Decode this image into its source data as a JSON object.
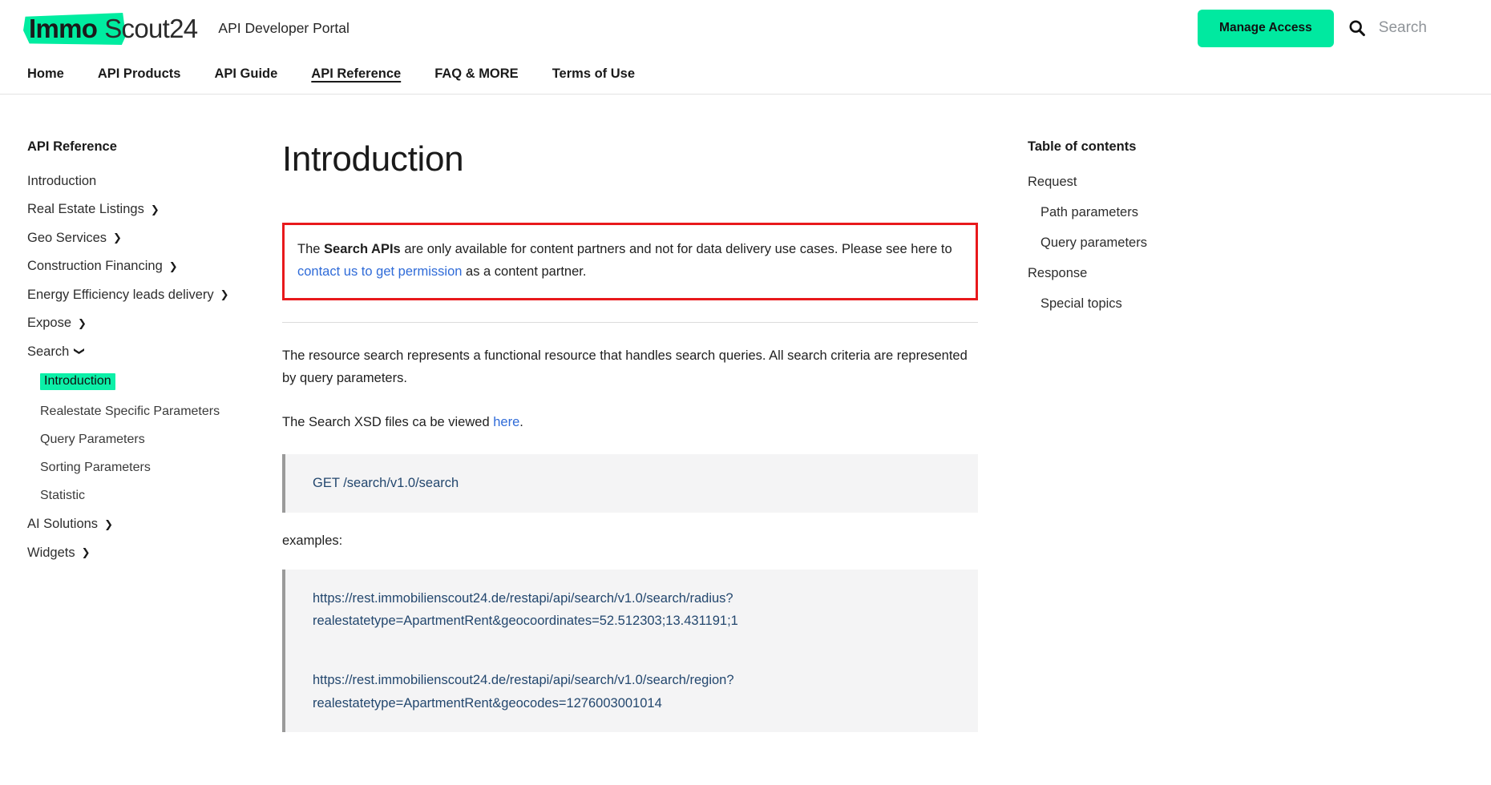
{
  "header": {
    "logo": {
      "immo": "Immo",
      "scout": "Scout24",
      "accent_color": "#00ECA0"
    },
    "portal_title": "API Developer Portal",
    "manage_access_label": "Manage Access",
    "search_placeholder": "Search",
    "search_value": ""
  },
  "nav": {
    "items": [
      {
        "label": "Home",
        "active": false
      },
      {
        "label": "API Products",
        "active": false
      },
      {
        "label": "API Guide",
        "active": false
      },
      {
        "label": "API Reference",
        "active": true
      },
      {
        "label": "FAQ & MORE",
        "active": false
      },
      {
        "label": "Terms of Use",
        "active": false
      }
    ]
  },
  "sidebar": {
    "title": "API Reference",
    "items": [
      {
        "label": "Introduction",
        "level": 1,
        "chevron": "",
        "highlighted": false
      },
      {
        "label": "Real Estate Listings",
        "level": 1,
        "chevron": "right",
        "highlighted": false
      },
      {
        "label": "Geo Services",
        "level": 1,
        "chevron": "right",
        "highlighted": false
      },
      {
        "label": "Construction Financing",
        "level": 1,
        "chevron": "right",
        "highlighted": false
      },
      {
        "label": "Energy Efficiency leads delivery",
        "level": 1,
        "chevron": "right",
        "highlighted": false
      },
      {
        "label": "Expose",
        "level": 1,
        "chevron": "right",
        "highlighted": false
      },
      {
        "label": "Search",
        "level": 1,
        "chevron": "down",
        "highlighted": false
      },
      {
        "label": "Introduction",
        "level": 2,
        "chevron": "",
        "highlighted": true
      },
      {
        "label": "Realestate Specific Parameters",
        "level": 2,
        "chevron": "",
        "highlighted": false
      },
      {
        "label": "Query Parameters",
        "level": 2,
        "chevron": "",
        "highlighted": false
      },
      {
        "label": "Sorting Parameters",
        "level": 2,
        "chevron": "",
        "highlighted": false
      },
      {
        "label": "Statistic",
        "level": 2,
        "chevron": "",
        "highlighted": false
      },
      {
        "label": "AI Solutions",
        "level": 1,
        "chevron": "right",
        "highlighted": false
      },
      {
        "label": "Widgets",
        "level": 1,
        "chevron": "right",
        "highlighted": false
      }
    ],
    "highlight_color": "#0CF0A8"
  },
  "main": {
    "page_title": "Introduction",
    "callout": {
      "border_color": "#E8191C",
      "text_before": "The ",
      "bold_text": "Search APIs",
      "text_mid": " are only available for content partners and not for data delivery use cases. Please see here to ",
      "link_text": "contact us to get permission",
      "text_after": " as a content partner.",
      "link_color": "#2f6bd8"
    },
    "paragraph_1": "The resource search represents a functional resource that handles search queries. All search criteria are represented by query parameters.",
    "paragraph_2_before": "The Search XSD files ca be viewed ",
    "paragraph_2_link": "here",
    "paragraph_2_after": ".",
    "endpoint_block": "GET /search/v1.0/search",
    "examples_label": "examples:",
    "example_urls": [
      "https://rest.immobilienscout24.de/restapi/api/search/v1.0/search/radius?realestatetype=ApartmentRent&geocoordinates=52.512303;13.431191;1",
      "https://rest.immobilienscout24.de/restapi/api/search/v1.0/search/region?realestatetype=ApartmentRent&geocodes=1276003001014"
    ],
    "code_text_color": "#23476e",
    "code_bg_color": "#f4f4f5"
  },
  "toc": {
    "title": "Table of contents",
    "items": [
      {
        "label": "Request",
        "sub": false
      },
      {
        "label": "Path parameters",
        "sub": true
      },
      {
        "label": "Query parameters",
        "sub": true
      },
      {
        "label": "Response",
        "sub": false
      },
      {
        "label": "Special topics",
        "sub": true
      }
    ]
  }
}
